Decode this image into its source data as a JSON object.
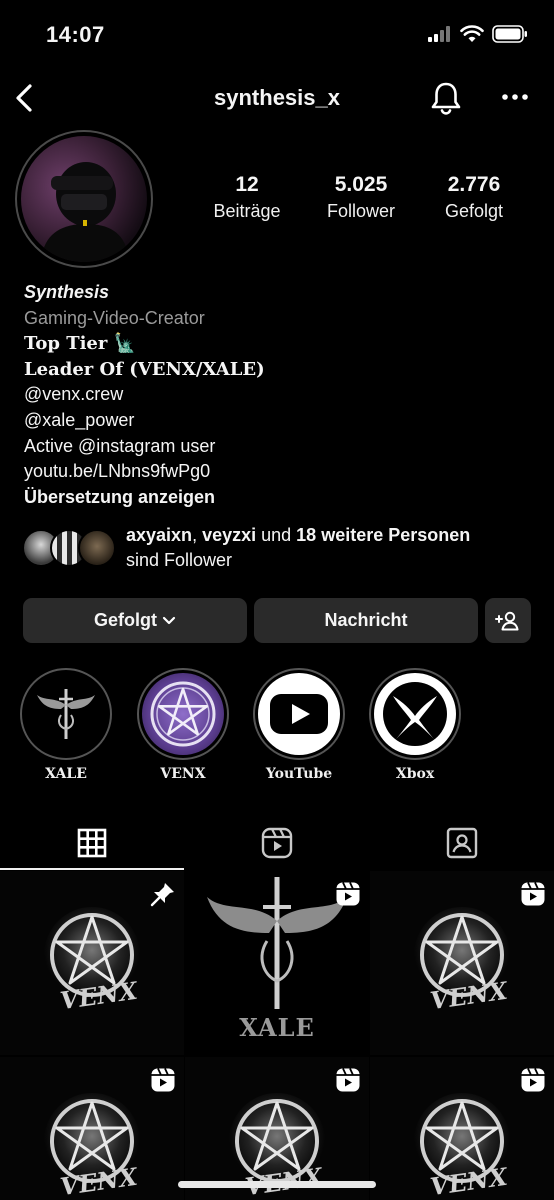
{
  "status_bar": {
    "time": "14:07"
  },
  "header": {
    "username": "synthesis_x"
  },
  "stats": [
    {
      "value": "12",
      "label": "Beiträge"
    },
    {
      "value": "5.025",
      "label": "Follower"
    },
    {
      "value": "2.776",
      "label": "Gefolgt"
    }
  ],
  "bio": {
    "name": "Synthesis",
    "category": "Gaming-Video-Creator",
    "line1": "Top Tier 🗽",
    "line2": "Leader Of (VENX/XALE)",
    "line3": "@venx.crew",
    "line4": "@xale_power",
    "line5": "Active @instagram user",
    "link": "youtu.be/LNbns9fwPg0",
    "translate": "Übersetzung anzeigen"
  },
  "followed_by": {
    "name1": "axyaixn",
    "sep": ", ",
    "name2": "veyzxi",
    "middle": " und ",
    "count": "18 weitere Personen",
    "suffix": "sind Follower"
  },
  "buttons": {
    "follow_label": "Gefolgt",
    "message_label": "Nachricht"
  },
  "highlights": [
    {
      "label": "XALE"
    },
    {
      "label": "VENX"
    },
    {
      "label": "YouTube"
    },
    {
      "label": "Xbox"
    }
  ],
  "grid": {
    "post_xale_caption": "XALE",
    "post_venx_caption": "VENX"
  },
  "colors": {
    "background": "#000000",
    "button_bg": "#2a2a2a",
    "muted_text": "#9a9a9a",
    "venx_purple": "#5b3d8f"
  }
}
